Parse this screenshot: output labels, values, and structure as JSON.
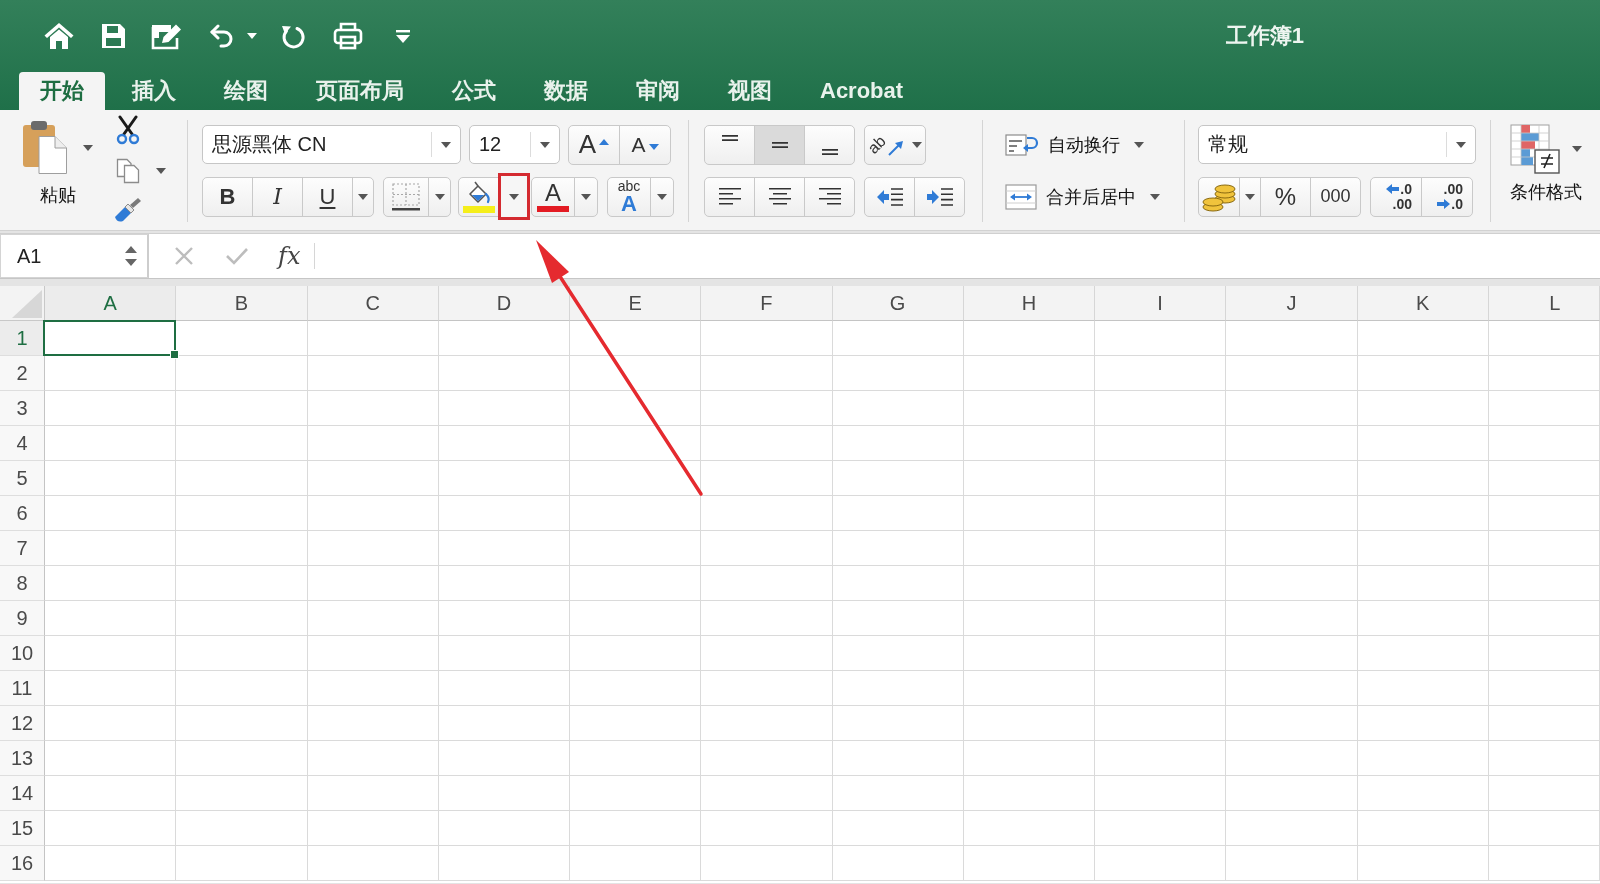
{
  "window": {
    "title": "工作簿1"
  },
  "tabs": [
    {
      "label": "开始",
      "selected": true
    },
    {
      "label": "插入",
      "selected": false
    },
    {
      "label": "绘图",
      "selected": false
    },
    {
      "label": "页面布局",
      "selected": false
    },
    {
      "label": "公式",
      "selected": false
    },
    {
      "label": "数据",
      "selected": false
    },
    {
      "label": "审阅",
      "selected": false
    },
    {
      "label": "视图",
      "selected": false
    },
    {
      "label": "Acrobat",
      "selected": false
    }
  ],
  "ribbon": {
    "paste": {
      "label": "粘贴"
    },
    "font_name": {
      "value": "思源黑体 CN"
    },
    "font_size": {
      "value": "12"
    },
    "font_size_buttons": [
      {
        "kind": "grow",
        "label": "A"
      },
      {
        "kind": "shrink",
        "label": "A"
      }
    ],
    "style_buttons": [
      {
        "kind": "bold",
        "label": "B"
      },
      {
        "kind": "italic",
        "label": "I"
      },
      {
        "kind": "underline",
        "label": "U"
      }
    ],
    "fill_color_dropdown": {
      "highlighted": true
    },
    "font_color": {
      "label": "A"
    },
    "phonetic": {
      "top": "abc",
      "bottom": "A"
    },
    "vertical_align": [
      {
        "kind": "top",
        "selected": false
      },
      {
        "kind": "middle",
        "selected": true
      },
      {
        "kind": "bottom",
        "selected": false
      }
    ],
    "orientation": {
      "label": "ab"
    },
    "horizontal_align": [
      {
        "kind": "left",
        "selected": false
      },
      {
        "kind": "center",
        "selected": false
      },
      {
        "kind": "right",
        "selected": false
      }
    ],
    "wrap_text": {
      "label": "自动换行"
    },
    "merge_center": {
      "label": "合并后居中"
    },
    "number_format": {
      "value": "常规"
    },
    "number_buttons": [
      {
        "kind": "accounting"
      },
      {
        "kind": "percent",
        "label": "%"
      },
      {
        "kind": "thousands",
        "label": "000"
      }
    ],
    "decimal_buttons": [
      {
        "kind": "increase",
        "top": ".0",
        "bottom": ".00"
      },
      {
        "kind": "decrease",
        "top": ".00",
        "bottom": ".0"
      }
    ],
    "conditional_format": {
      "label": "条件格式"
    }
  },
  "formula_bar": {
    "name_box": "A1",
    "function_label": "fx"
  },
  "sheet": {
    "columns": [
      {
        "label": "A",
        "selected": true
      },
      {
        "label": "B",
        "selected": false
      },
      {
        "label": "C",
        "selected": false
      },
      {
        "label": "D",
        "selected": false
      },
      {
        "label": "E",
        "selected": false
      },
      {
        "label": "F",
        "selected": false
      },
      {
        "label": "G",
        "selected": false
      },
      {
        "label": "H",
        "selected": false
      },
      {
        "label": "I",
        "selected": false
      },
      {
        "label": "J",
        "selected": false
      },
      {
        "label": "K",
        "selected": false
      },
      {
        "label": "L",
        "selected": false
      }
    ],
    "rows": [
      {
        "label": "1",
        "selected": true
      },
      {
        "label": "2",
        "selected": false
      },
      {
        "label": "3",
        "selected": false
      },
      {
        "label": "4",
        "selected": false
      },
      {
        "label": "5",
        "selected": false
      },
      {
        "label": "6",
        "selected": false
      },
      {
        "label": "7",
        "selected": false
      },
      {
        "label": "8",
        "selected": false
      },
      {
        "label": "9",
        "selected": false
      },
      {
        "label": "10",
        "selected": false
      },
      {
        "label": "11",
        "selected": false
      },
      {
        "label": "12",
        "selected": false
      },
      {
        "label": "13",
        "selected": false
      },
      {
        "label": "14",
        "selected": false
      },
      {
        "label": "15",
        "selected": false
      },
      {
        "label": "16",
        "selected": false
      }
    ]
  },
  "annotation_arrow": true
}
